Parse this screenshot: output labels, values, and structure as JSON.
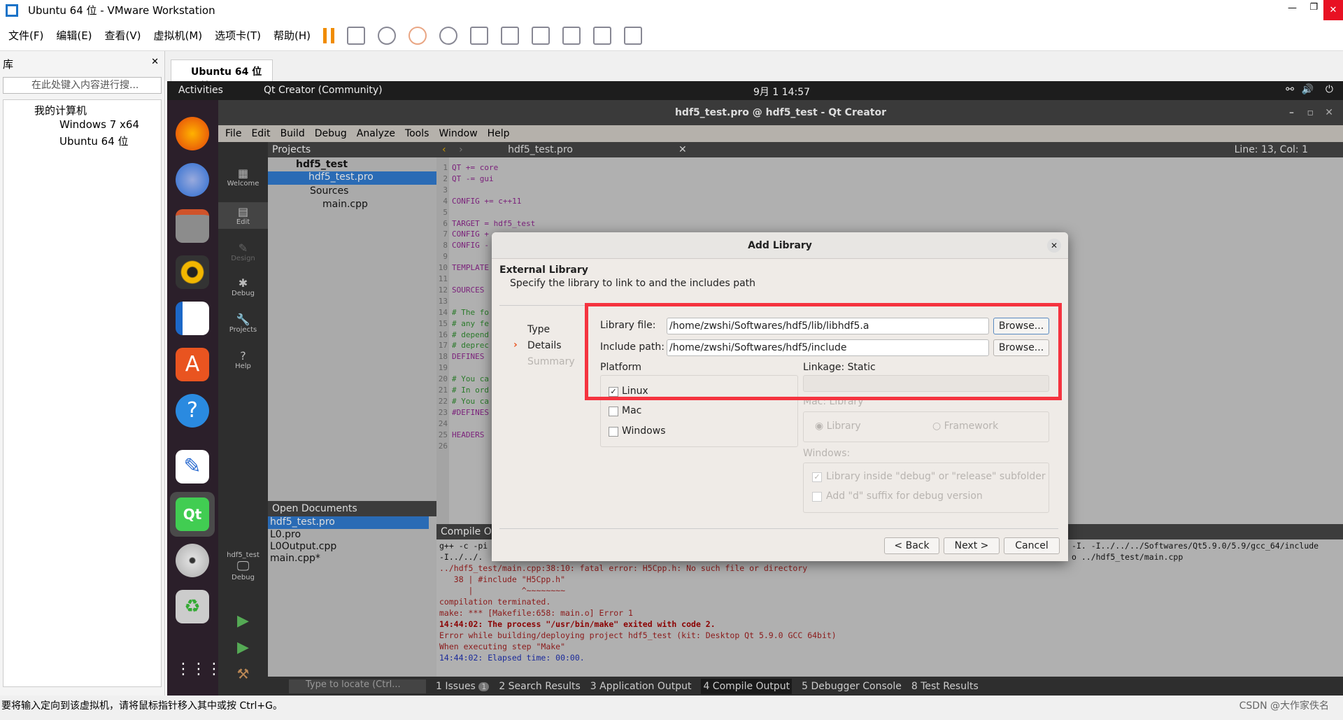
{
  "vmware": {
    "title": "Ubuntu 64 位 - VMware Workstation",
    "menu": [
      "文件(F)",
      "编辑(E)",
      "查看(V)",
      "虚拟机(M)",
      "选项卡(T)",
      "帮助(H)"
    ],
    "library": {
      "title": "库",
      "search_placeholder": "在此处键入内容进行搜...",
      "tree": [
        "我的计算机",
        "Windows 7 x64",
        "Ubuntu 64 位"
      ]
    },
    "tab": "Ubuntu 64 位",
    "status": "要将输入定向到该虚拟机，请将鼠标指针移入其中或按 Ctrl+G。",
    "watermark": "CSDN @大作家佚名"
  },
  "ubuntu": {
    "activities": "Activities",
    "app": "Qt Creator (Community)",
    "clock": "9月 1  14:57"
  },
  "qt": {
    "title": "hdf5_test.pro @ hdf5_test - Qt Creator",
    "menu": [
      "File",
      "Edit",
      "Build",
      "Debug",
      "Analyze",
      "Tools",
      "Window",
      "Help"
    ],
    "modes": [
      "Welcome",
      "Edit",
      "Design",
      "Debug",
      "Projects",
      "Help"
    ],
    "kit": {
      "project": "hdf5_test",
      "label": "Debug"
    },
    "projects": {
      "header": "Projects",
      "tree": [
        "hdf5_test",
        "hdf5_test.pro",
        "Sources",
        "main.cpp"
      ]
    },
    "open_docs": {
      "header": "Open Documents",
      "items": [
        "hdf5_test.pro",
        "L0.pro",
        "L0Output.cpp",
        "main.cpp*"
      ]
    },
    "editor": {
      "file": "hdf5_test.pro",
      "position": "Line: 13, Col: 1",
      "lines": [
        "QT += core",
        "QT -= gui",
        "",
        "CONFIG += c++11",
        "",
        "TARGET = hdf5_test",
        "CONFIG +",
        "CONFIG -",
        "",
        "TEMPLATE",
        "",
        "SOURCES",
        "",
        "# The fo",
        "# any fe",
        "# depend",
        "# deprec",
        "DEFINES",
        "",
        "# You ca",
        "# In ord",
        "# You ca",
        "#DEFINES",
        "",
        "HEADERS",
        ""
      ]
    },
    "compile": {
      "header": "Compile Ou",
      "line1_left": "g++ -c -pi",
      "line1_right": "-I. -I../../../Softwares/Qt5.9.0/5.9/gcc_64/include",
      "line2_left": "-I../../.",
      "line2_right": "o ../hdf5_test/main.cpp",
      "lines": [
        "../hdf5_test/main.cpp:38:10: fatal error: H5Cpp.h: No such file or directory",
        "   38 | #include \"H5Cpp.h\"",
        "      |          ^~~~~~~~~",
        "compilation terminated.",
        "make: *** [Makefile:658: main.o] Error 1",
        "14:44:02: The process \"/usr/bin/make\" exited with code 2.",
        "Error while building/deploying project hdf5_test (kit: Desktop Qt 5.9.0 GCC 64bit)",
        "When executing step \"Make\"",
        "14:44:02: Elapsed time: 00:00."
      ]
    },
    "locator_placeholder": "Type to locate (Ctrl...",
    "bottom_tabs": [
      "1 Issues",
      "2 Search Results",
      "3 Application Output",
      "4 Compile Output",
      "5 Debugger Console",
      "8 Test Results"
    ],
    "issues_count": "1"
  },
  "dialog": {
    "title": "Add Library",
    "heading": "External Library",
    "subheading": "Specify the library to link to and the includes path",
    "steps": [
      "Type",
      "Details",
      "Summary"
    ],
    "library_file_label": "Library file:",
    "library_file": "/home/zwshi/Softwares/hdf5/lib/libhdf5.a",
    "include_path_label": "Include path:",
    "include_path": "/home/zwshi/Softwares/hdf5/include",
    "browse": "Browse...",
    "platform_label": "Platform",
    "platforms": [
      {
        "label": "Linux",
        "checked": true
      },
      {
        "label": "Mac",
        "checked": false
      },
      {
        "label": "Windows",
        "checked": false
      }
    ],
    "linkage_label": "Linkage: Static",
    "mac_label": "Mac: Library",
    "mac_options": [
      "Library",
      "Framework"
    ],
    "windows_label": "Windows:",
    "windows_options": [
      {
        "label": "Library inside \"debug\" or \"release\" subfolder",
        "checked": true
      },
      {
        "label": "Add \"d\" suffix for debug version",
        "checked": false
      }
    ],
    "back": "< Back",
    "next": "Next >",
    "cancel": "Cancel",
    "highlight_color": "#f5333f"
  }
}
